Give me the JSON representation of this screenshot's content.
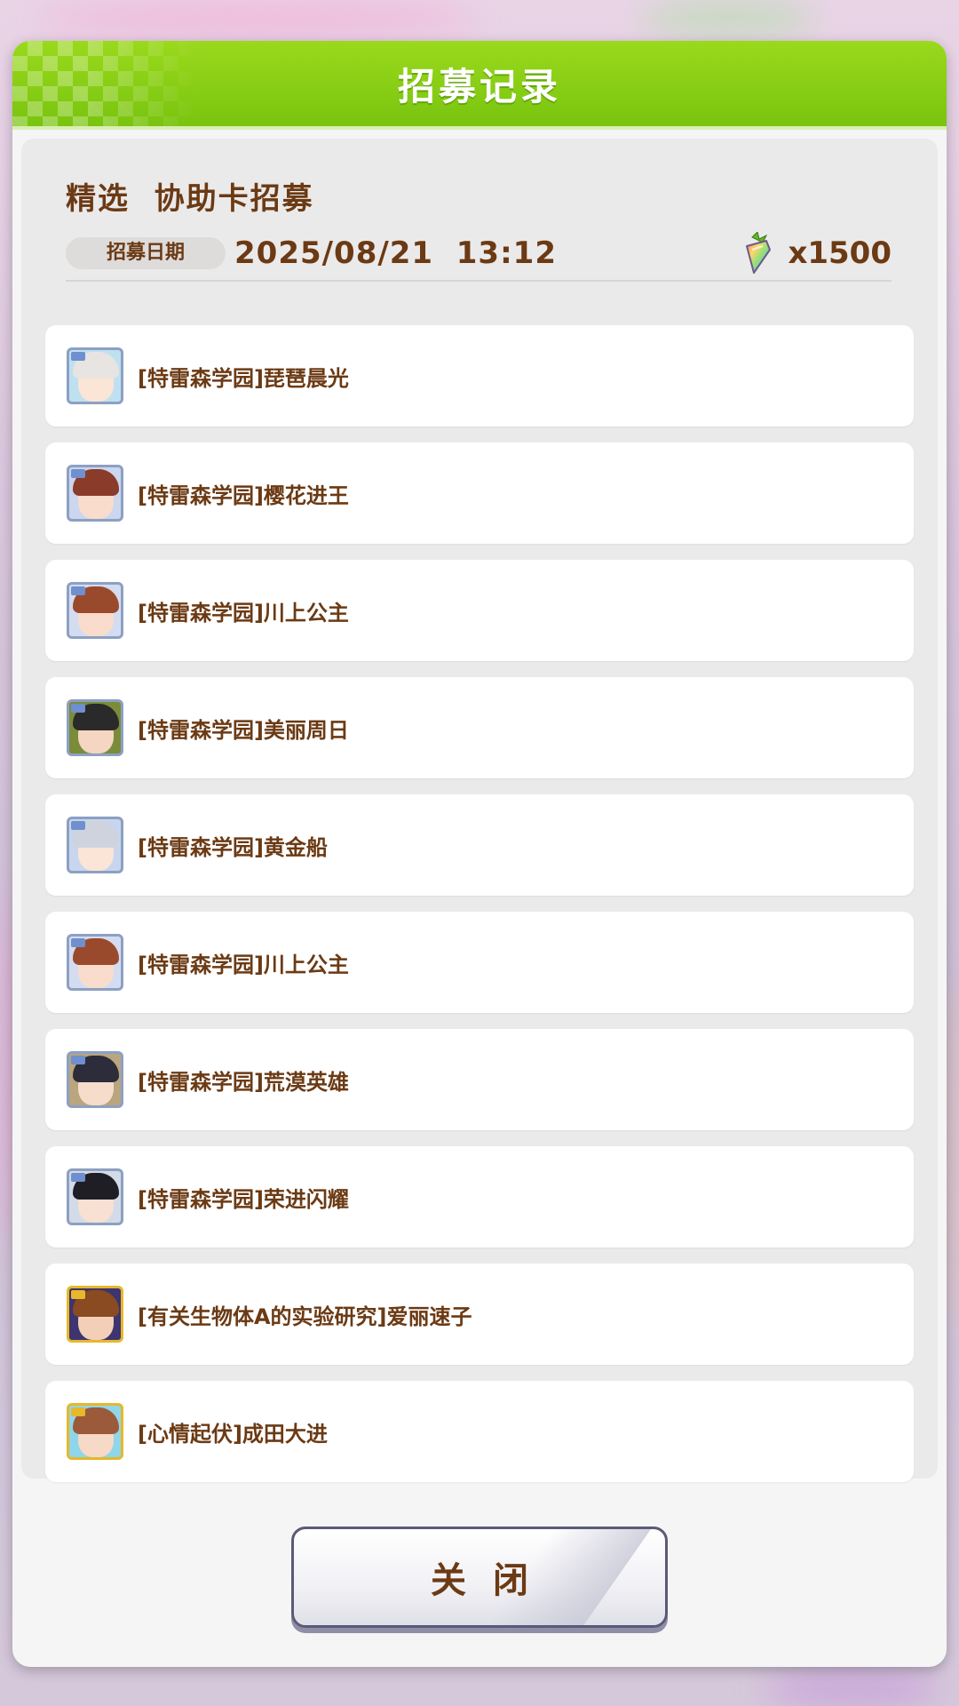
{
  "modal": {
    "title": "招募记录"
  },
  "record": {
    "gacha_name": "精选  协助卡招募",
    "date_label": "招募日期",
    "date_value": "2025/08/21  13:12",
    "cost_icon": "rainbow-carrot-icon",
    "cost_value": "x1500"
  },
  "results": [
    {
      "name": "[特雷森学园]琵琶晨光",
      "rarity": "R",
      "hair": "#e8e4e2",
      "face": "#fbe5d6",
      "bg": "#bfe0f0"
    },
    {
      "name": "[特雷森学园]樱花进王",
      "rarity": "R",
      "hair": "#8b3b2a",
      "face": "#f9dccb",
      "bg": "#cbd6ef"
    },
    {
      "name": "[特雷森学园]川上公主",
      "rarity": "R",
      "hair": "#9a4a2c",
      "face": "#f9dccb",
      "bg": "#d4dcf1"
    },
    {
      "name": "[特雷森学园]美丽周日",
      "rarity": "R",
      "hair": "#2a2a2a",
      "face": "#f4d6c3",
      "bg": "#7a8c3a"
    },
    {
      "name": "[特雷森学园]黄金船",
      "rarity": "R",
      "hair": "#cfd3de",
      "face": "#fbe5d6",
      "bg": "#c7d6ee"
    },
    {
      "name": "[特雷森学园]川上公主",
      "rarity": "R",
      "hair": "#9a4a2c",
      "face": "#f9dccb",
      "bg": "#d4dcf1"
    },
    {
      "name": "[特雷森学园]荒漠英雄",
      "rarity": "R",
      "hair": "#2c2c3a",
      "face": "#f6dccb",
      "bg": "#b9a57e"
    },
    {
      "name": "[特雷森学园]荣进闪耀",
      "rarity": "R",
      "hair": "#1e1e24",
      "face": "#f8e0d2",
      "bg": "#d3dbe8"
    },
    {
      "name": "[有关生物体A的实验研究]爱丽速子",
      "rarity": "SR",
      "hair": "#8a4a22",
      "face": "#f3cfb8",
      "bg": "#3d3470"
    },
    {
      "name": "[心情起伏]成田大进",
      "rarity": "SR",
      "hair": "#9b5a3a",
      "face": "#f6d9c6",
      "bg": "#8fd6ea"
    }
  ],
  "footer": {
    "close_label": "关闭"
  },
  "colors": {
    "header_green": "#86cc14",
    "text_brown": "#6b3a14"
  }
}
